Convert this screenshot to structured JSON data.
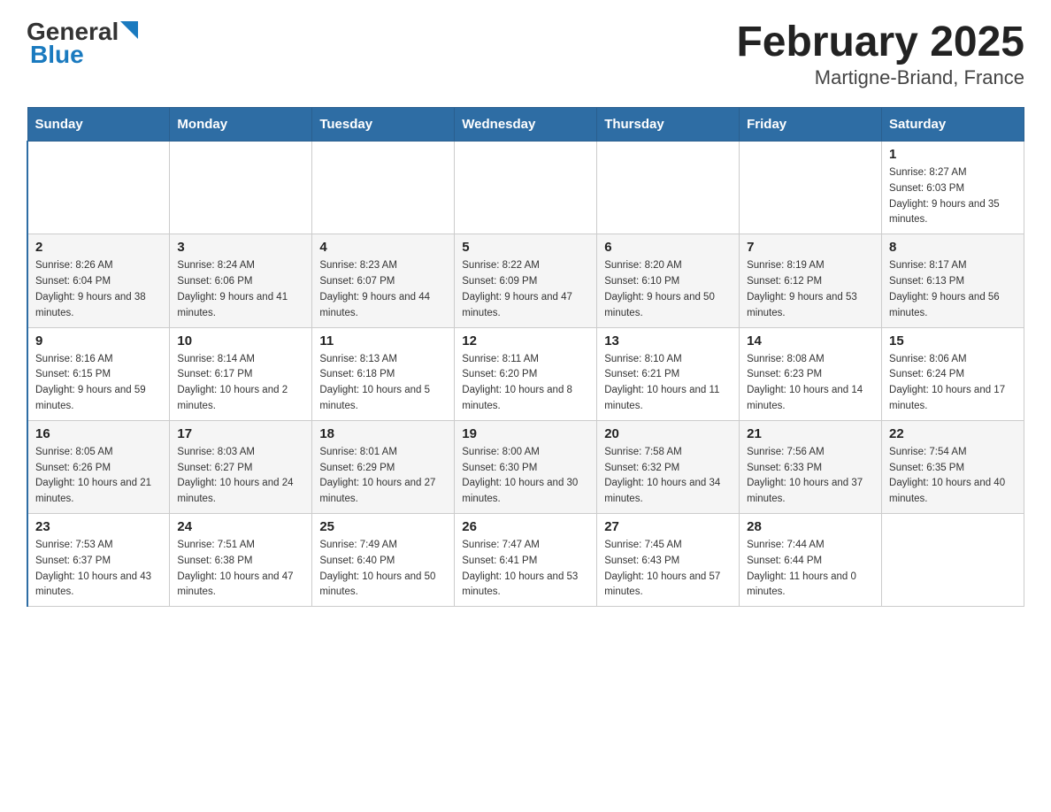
{
  "header": {
    "logo_general": "General",
    "logo_blue": "Blue",
    "title": "February 2025",
    "subtitle": "Martigne-Briand, France"
  },
  "days_of_week": [
    "Sunday",
    "Monday",
    "Tuesday",
    "Wednesday",
    "Thursday",
    "Friday",
    "Saturday"
  ],
  "weeks": [
    [
      {
        "day": "",
        "info": ""
      },
      {
        "day": "",
        "info": ""
      },
      {
        "day": "",
        "info": ""
      },
      {
        "day": "",
        "info": ""
      },
      {
        "day": "",
        "info": ""
      },
      {
        "day": "",
        "info": ""
      },
      {
        "day": "1",
        "info": "Sunrise: 8:27 AM\nSunset: 6:03 PM\nDaylight: 9 hours and 35 minutes."
      }
    ],
    [
      {
        "day": "2",
        "info": "Sunrise: 8:26 AM\nSunset: 6:04 PM\nDaylight: 9 hours and 38 minutes."
      },
      {
        "day": "3",
        "info": "Sunrise: 8:24 AM\nSunset: 6:06 PM\nDaylight: 9 hours and 41 minutes."
      },
      {
        "day": "4",
        "info": "Sunrise: 8:23 AM\nSunset: 6:07 PM\nDaylight: 9 hours and 44 minutes."
      },
      {
        "day": "5",
        "info": "Sunrise: 8:22 AM\nSunset: 6:09 PM\nDaylight: 9 hours and 47 minutes."
      },
      {
        "day": "6",
        "info": "Sunrise: 8:20 AM\nSunset: 6:10 PM\nDaylight: 9 hours and 50 minutes."
      },
      {
        "day": "7",
        "info": "Sunrise: 8:19 AM\nSunset: 6:12 PM\nDaylight: 9 hours and 53 minutes."
      },
      {
        "day": "8",
        "info": "Sunrise: 8:17 AM\nSunset: 6:13 PM\nDaylight: 9 hours and 56 minutes."
      }
    ],
    [
      {
        "day": "9",
        "info": "Sunrise: 8:16 AM\nSunset: 6:15 PM\nDaylight: 9 hours and 59 minutes."
      },
      {
        "day": "10",
        "info": "Sunrise: 8:14 AM\nSunset: 6:17 PM\nDaylight: 10 hours and 2 minutes."
      },
      {
        "day": "11",
        "info": "Sunrise: 8:13 AM\nSunset: 6:18 PM\nDaylight: 10 hours and 5 minutes."
      },
      {
        "day": "12",
        "info": "Sunrise: 8:11 AM\nSunset: 6:20 PM\nDaylight: 10 hours and 8 minutes."
      },
      {
        "day": "13",
        "info": "Sunrise: 8:10 AM\nSunset: 6:21 PM\nDaylight: 10 hours and 11 minutes."
      },
      {
        "day": "14",
        "info": "Sunrise: 8:08 AM\nSunset: 6:23 PM\nDaylight: 10 hours and 14 minutes."
      },
      {
        "day": "15",
        "info": "Sunrise: 8:06 AM\nSunset: 6:24 PM\nDaylight: 10 hours and 17 minutes."
      }
    ],
    [
      {
        "day": "16",
        "info": "Sunrise: 8:05 AM\nSunset: 6:26 PM\nDaylight: 10 hours and 21 minutes."
      },
      {
        "day": "17",
        "info": "Sunrise: 8:03 AM\nSunset: 6:27 PM\nDaylight: 10 hours and 24 minutes."
      },
      {
        "day": "18",
        "info": "Sunrise: 8:01 AM\nSunset: 6:29 PM\nDaylight: 10 hours and 27 minutes."
      },
      {
        "day": "19",
        "info": "Sunrise: 8:00 AM\nSunset: 6:30 PM\nDaylight: 10 hours and 30 minutes."
      },
      {
        "day": "20",
        "info": "Sunrise: 7:58 AM\nSunset: 6:32 PM\nDaylight: 10 hours and 34 minutes."
      },
      {
        "day": "21",
        "info": "Sunrise: 7:56 AM\nSunset: 6:33 PM\nDaylight: 10 hours and 37 minutes."
      },
      {
        "day": "22",
        "info": "Sunrise: 7:54 AM\nSunset: 6:35 PM\nDaylight: 10 hours and 40 minutes."
      }
    ],
    [
      {
        "day": "23",
        "info": "Sunrise: 7:53 AM\nSunset: 6:37 PM\nDaylight: 10 hours and 43 minutes."
      },
      {
        "day": "24",
        "info": "Sunrise: 7:51 AM\nSunset: 6:38 PM\nDaylight: 10 hours and 47 minutes."
      },
      {
        "day": "25",
        "info": "Sunrise: 7:49 AM\nSunset: 6:40 PM\nDaylight: 10 hours and 50 minutes."
      },
      {
        "day": "26",
        "info": "Sunrise: 7:47 AM\nSunset: 6:41 PM\nDaylight: 10 hours and 53 minutes."
      },
      {
        "day": "27",
        "info": "Sunrise: 7:45 AM\nSunset: 6:43 PM\nDaylight: 10 hours and 57 minutes."
      },
      {
        "day": "28",
        "info": "Sunrise: 7:44 AM\nSunset: 6:44 PM\nDaylight: 11 hours and 0 minutes."
      },
      {
        "day": "",
        "info": ""
      }
    ]
  ]
}
